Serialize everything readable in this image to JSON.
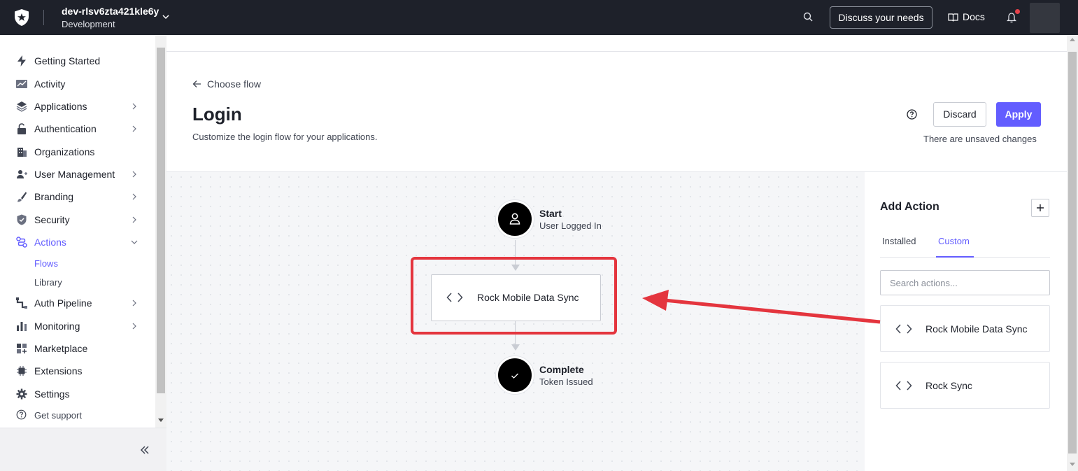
{
  "topbar": {
    "tenant_name": "dev-rlsv6zta421kle6y",
    "tenant_env": "Development",
    "discuss_label": "Discuss your needs",
    "docs_label": "Docs"
  },
  "sidebar": {
    "items": [
      {
        "label": "Getting Started",
        "icon": "lightning-icon"
      },
      {
        "label": "Activity",
        "icon": "activity-icon"
      },
      {
        "label": "Applications",
        "icon": "layers-icon"
      },
      {
        "label": "Authentication",
        "icon": "lock-icon"
      },
      {
        "label": "Organizations",
        "icon": "building-icon"
      },
      {
        "label": "User Management",
        "icon": "users-icon"
      },
      {
        "label": "Branding",
        "icon": "brush-icon"
      },
      {
        "label": "Security",
        "icon": "shield-icon"
      },
      {
        "label": "Actions",
        "icon": "actions-icon"
      },
      {
        "label": "Auth Pipeline",
        "icon": "pipeline-icon"
      },
      {
        "label": "Monitoring",
        "icon": "bar-chart-icon"
      },
      {
        "label": "Marketplace",
        "icon": "grid-plus-icon"
      },
      {
        "label": "Extensions",
        "icon": "chip-icon"
      },
      {
        "label": "Settings",
        "icon": "gear-icon"
      }
    ],
    "sub_items": [
      "Flows",
      "Library"
    ],
    "support_label": "Get support"
  },
  "page": {
    "back_label": "Choose flow",
    "title": "Login",
    "description": "Customize the login flow for your applications.",
    "discard_label": "Discard",
    "apply_label": "Apply",
    "unsaved_text": "There are unsaved changes"
  },
  "flow": {
    "start_title": "Start",
    "start_sub": "User Logged In",
    "action_label": "Rock Mobile Data Sync",
    "end_title": "Complete",
    "end_sub": "Token Issued"
  },
  "panel": {
    "title": "Add Action",
    "tabs": [
      "Installed",
      "Custom"
    ],
    "active_tab": "Custom",
    "search_placeholder": "Search actions...",
    "actions": [
      "Rock Mobile Data Sync",
      "Rock Sync"
    ]
  },
  "colors": {
    "accent": "#635dff",
    "topbar": "#1e212a",
    "annotation": "#e4353e"
  }
}
